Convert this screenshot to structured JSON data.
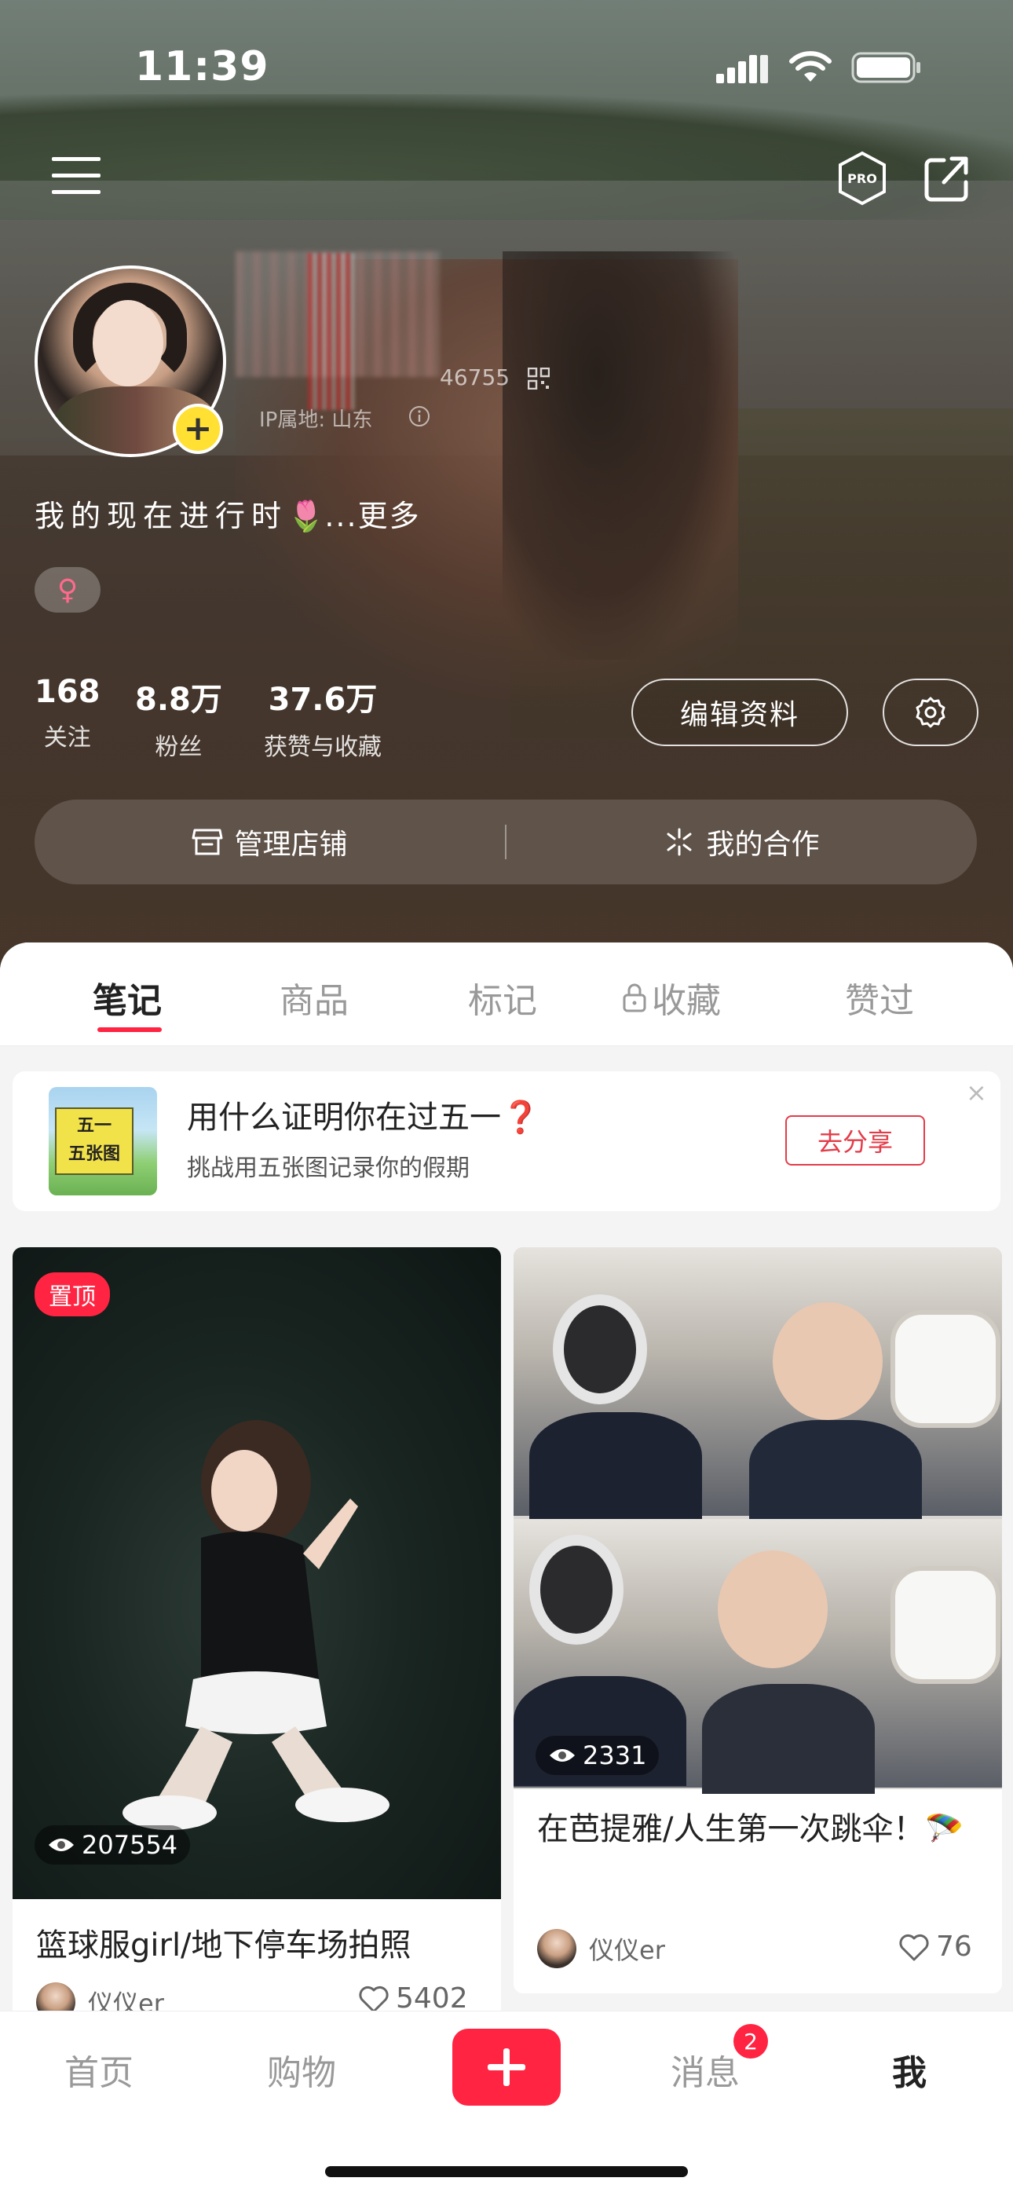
{
  "status_bar": {
    "time": "11:39"
  },
  "profile": {
    "redbook_id_partial": "46755",
    "ip_location": "IP属地: 山东",
    "bio": "我的现在进行时",
    "bio_emoji": "🌷",
    "bio_more": "...更多",
    "gender_symbol": "♀"
  },
  "stats": [
    {
      "value": "168",
      "label": "关注"
    },
    {
      "value": "8.8万",
      "label": "粉丝"
    },
    {
      "value": "37.6万",
      "label": "获赞与收藏"
    }
  ],
  "buttons": {
    "edit_profile": "编辑资料",
    "manage_store": "管理店铺",
    "my_cooperation": "我的合作"
  },
  "tabs": [
    {
      "label": "笔记",
      "active": true
    },
    {
      "label": "商品",
      "active": false
    },
    {
      "label": "标记",
      "active": false
    },
    {
      "label": "收藏",
      "active": false
    },
    {
      "label": "赞过",
      "active": false
    }
  ],
  "banner": {
    "thumb_text_1": "五一",
    "thumb_text_2": "五张图",
    "title": "用什么证明你在过五一",
    "title_mark": "❓",
    "subtitle": "挑战用五张图记录你的假期",
    "action": "去分享",
    "close": "×"
  },
  "notes": [
    {
      "pinned_label": "置顶",
      "views": "207554",
      "title": "篮球服girl/地下停车场拍照",
      "author": "仪仪er",
      "likes": "5402"
    },
    {
      "views": "2331",
      "title": "在芭提雅/人生第一次跳伞！🪂",
      "author": "仪仪er",
      "likes": "76"
    }
  ],
  "bottom_nav": {
    "home": "首页",
    "shop": "购物",
    "messages": "消息",
    "messages_badge": "2",
    "me": "我"
  },
  "colors": {
    "brand_red": "#ff2442",
    "avatar_plus": "#ffe033"
  }
}
